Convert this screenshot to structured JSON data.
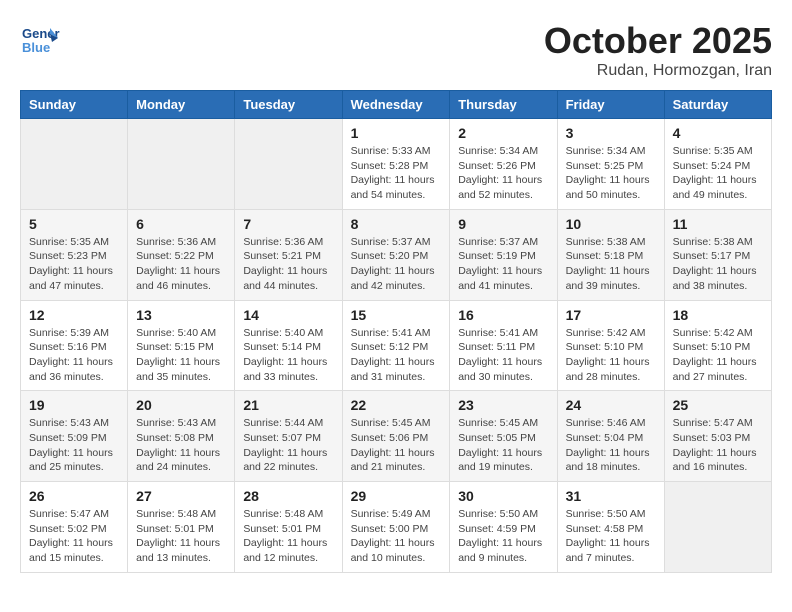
{
  "header": {
    "logo_line1": "General",
    "logo_line2": "Blue",
    "month_title": "October 2025",
    "location": "Rudan, Hormozgan, Iran"
  },
  "weekdays": [
    "Sunday",
    "Monday",
    "Tuesday",
    "Wednesday",
    "Thursday",
    "Friday",
    "Saturday"
  ],
  "weeks": [
    [
      {
        "day": "",
        "info": ""
      },
      {
        "day": "",
        "info": ""
      },
      {
        "day": "",
        "info": ""
      },
      {
        "day": "1",
        "info": "Sunrise: 5:33 AM\nSunset: 5:28 PM\nDaylight: 11 hours and 54 minutes."
      },
      {
        "day": "2",
        "info": "Sunrise: 5:34 AM\nSunset: 5:26 PM\nDaylight: 11 hours and 52 minutes."
      },
      {
        "day": "3",
        "info": "Sunrise: 5:34 AM\nSunset: 5:25 PM\nDaylight: 11 hours and 50 minutes."
      },
      {
        "day": "4",
        "info": "Sunrise: 5:35 AM\nSunset: 5:24 PM\nDaylight: 11 hours and 49 minutes."
      }
    ],
    [
      {
        "day": "5",
        "info": "Sunrise: 5:35 AM\nSunset: 5:23 PM\nDaylight: 11 hours and 47 minutes."
      },
      {
        "day": "6",
        "info": "Sunrise: 5:36 AM\nSunset: 5:22 PM\nDaylight: 11 hours and 46 minutes."
      },
      {
        "day": "7",
        "info": "Sunrise: 5:36 AM\nSunset: 5:21 PM\nDaylight: 11 hours and 44 minutes."
      },
      {
        "day": "8",
        "info": "Sunrise: 5:37 AM\nSunset: 5:20 PM\nDaylight: 11 hours and 42 minutes."
      },
      {
        "day": "9",
        "info": "Sunrise: 5:37 AM\nSunset: 5:19 PM\nDaylight: 11 hours and 41 minutes."
      },
      {
        "day": "10",
        "info": "Sunrise: 5:38 AM\nSunset: 5:18 PM\nDaylight: 11 hours and 39 minutes."
      },
      {
        "day": "11",
        "info": "Sunrise: 5:38 AM\nSunset: 5:17 PM\nDaylight: 11 hours and 38 minutes."
      }
    ],
    [
      {
        "day": "12",
        "info": "Sunrise: 5:39 AM\nSunset: 5:16 PM\nDaylight: 11 hours and 36 minutes."
      },
      {
        "day": "13",
        "info": "Sunrise: 5:40 AM\nSunset: 5:15 PM\nDaylight: 11 hours and 35 minutes."
      },
      {
        "day": "14",
        "info": "Sunrise: 5:40 AM\nSunset: 5:14 PM\nDaylight: 11 hours and 33 minutes."
      },
      {
        "day": "15",
        "info": "Sunrise: 5:41 AM\nSunset: 5:12 PM\nDaylight: 11 hours and 31 minutes."
      },
      {
        "day": "16",
        "info": "Sunrise: 5:41 AM\nSunset: 5:11 PM\nDaylight: 11 hours and 30 minutes."
      },
      {
        "day": "17",
        "info": "Sunrise: 5:42 AM\nSunset: 5:10 PM\nDaylight: 11 hours and 28 minutes."
      },
      {
        "day": "18",
        "info": "Sunrise: 5:42 AM\nSunset: 5:10 PM\nDaylight: 11 hours and 27 minutes."
      }
    ],
    [
      {
        "day": "19",
        "info": "Sunrise: 5:43 AM\nSunset: 5:09 PM\nDaylight: 11 hours and 25 minutes."
      },
      {
        "day": "20",
        "info": "Sunrise: 5:43 AM\nSunset: 5:08 PM\nDaylight: 11 hours and 24 minutes."
      },
      {
        "day": "21",
        "info": "Sunrise: 5:44 AM\nSunset: 5:07 PM\nDaylight: 11 hours and 22 minutes."
      },
      {
        "day": "22",
        "info": "Sunrise: 5:45 AM\nSunset: 5:06 PM\nDaylight: 11 hours and 21 minutes."
      },
      {
        "day": "23",
        "info": "Sunrise: 5:45 AM\nSunset: 5:05 PM\nDaylight: 11 hours and 19 minutes."
      },
      {
        "day": "24",
        "info": "Sunrise: 5:46 AM\nSunset: 5:04 PM\nDaylight: 11 hours and 18 minutes."
      },
      {
        "day": "25",
        "info": "Sunrise: 5:47 AM\nSunset: 5:03 PM\nDaylight: 11 hours and 16 minutes."
      }
    ],
    [
      {
        "day": "26",
        "info": "Sunrise: 5:47 AM\nSunset: 5:02 PM\nDaylight: 11 hours and 15 minutes."
      },
      {
        "day": "27",
        "info": "Sunrise: 5:48 AM\nSunset: 5:01 PM\nDaylight: 11 hours and 13 minutes."
      },
      {
        "day": "28",
        "info": "Sunrise: 5:48 AM\nSunset: 5:01 PM\nDaylight: 11 hours and 12 minutes."
      },
      {
        "day": "29",
        "info": "Sunrise: 5:49 AM\nSunset: 5:00 PM\nDaylight: 11 hours and 10 minutes."
      },
      {
        "day": "30",
        "info": "Sunrise: 5:50 AM\nSunset: 4:59 PM\nDaylight: 11 hours and 9 minutes."
      },
      {
        "day": "31",
        "info": "Sunrise: 5:50 AM\nSunset: 4:58 PM\nDaylight: 11 hours and 7 minutes."
      },
      {
        "day": "",
        "info": ""
      }
    ]
  ]
}
